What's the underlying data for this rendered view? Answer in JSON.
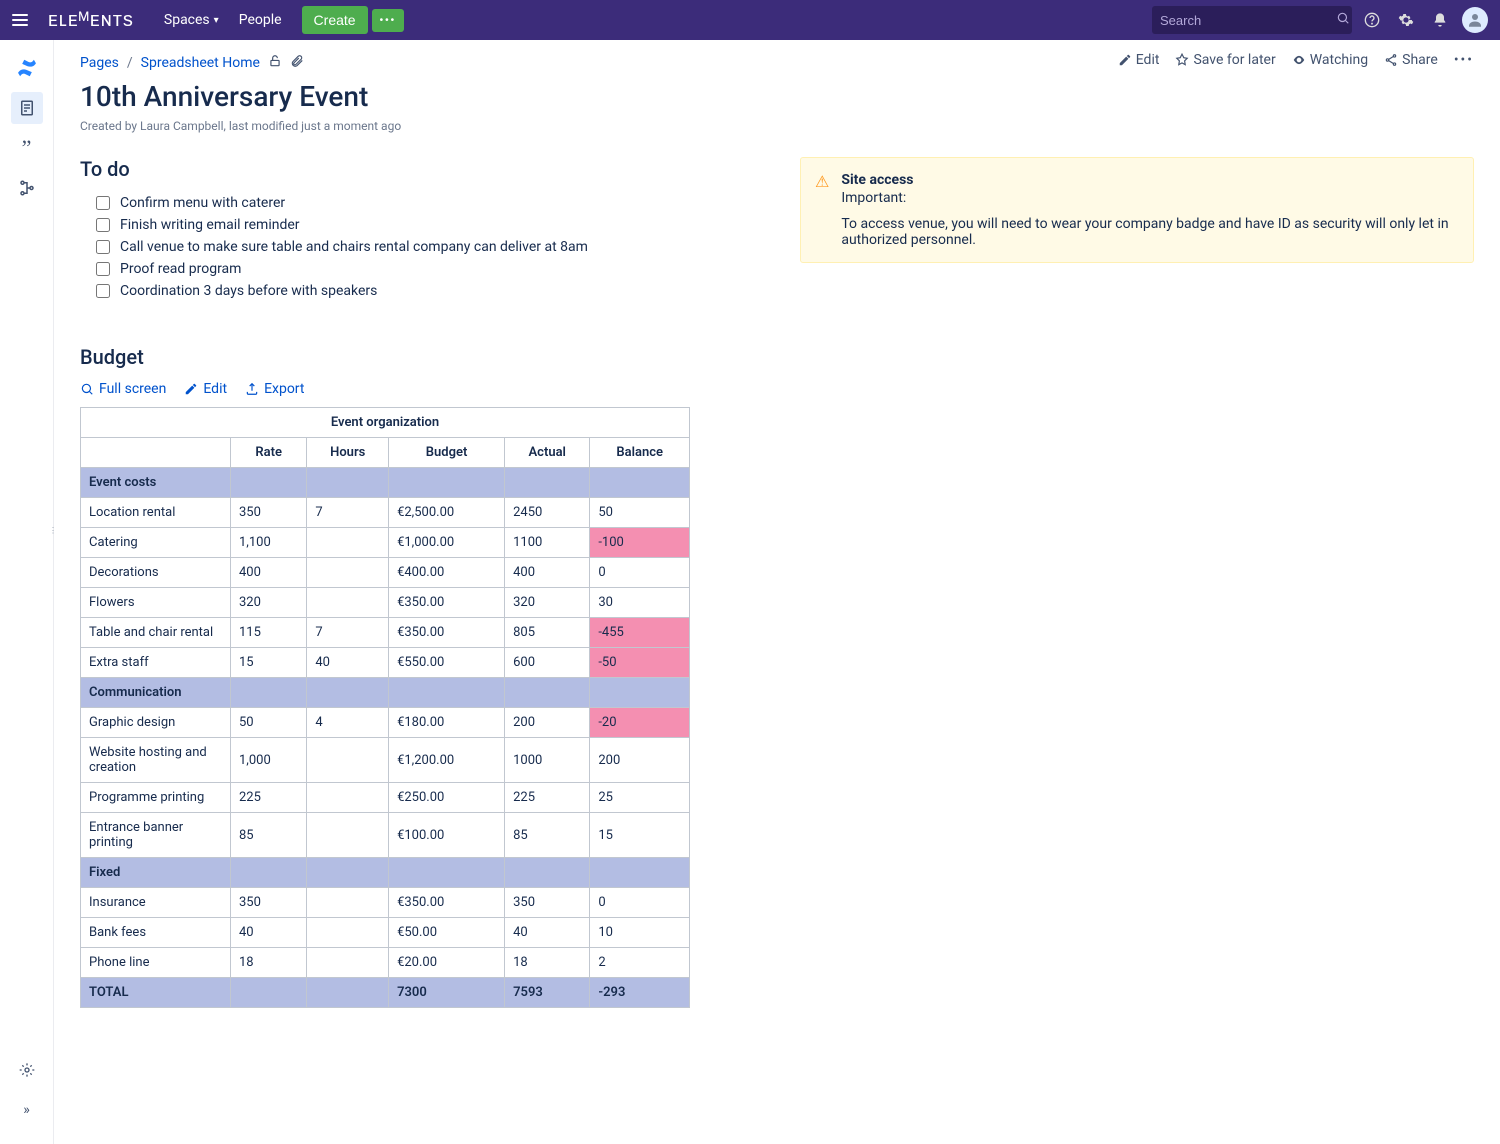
{
  "topbar": {
    "logo": "ᴇʟᴇᴹᴇɴᴛs",
    "spaces": "Spaces",
    "people": "People",
    "create": "Create",
    "more": "•••",
    "search_placeholder": "Search"
  },
  "breadcrumb": {
    "pages": "Pages",
    "home": "Spreadsheet Home"
  },
  "actions": {
    "edit": "Edit",
    "save": "Save for later",
    "watching": "Watching",
    "share": "Share"
  },
  "page": {
    "title": "10th Anniversary Event",
    "byline": "Created by Laura Campbell, last modified just a moment ago"
  },
  "todo": {
    "heading": "To do",
    "items": [
      "Confirm menu with caterer",
      "Finish writing email reminder",
      "Call venue to make sure table and chairs rental company can deliver at 8am",
      "Proof read program",
      "Coordination 3 days before with speakers"
    ]
  },
  "info": {
    "title": "Site access",
    "subtitle": "Important:",
    "body": "To access venue, you will need to wear your company badge and have ID as security will only let in authorized personnel."
  },
  "budget": {
    "heading": "Budget",
    "toolbar": {
      "fullscreen": "Full screen",
      "edit": "Edit",
      "export": "Export"
    },
    "table_title": "Event organization",
    "columns": [
      "",
      "Rate",
      "Hours",
      "Budget",
      "Actual",
      "Balance"
    ],
    "sections": [
      {
        "name": "Event costs",
        "rows": [
          {
            "label": "Location rental",
            "rate": "350",
            "hours": "7",
            "budget": "€2,500.00",
            "actual": "2450",
            "balance": "50",
            "neg": false
          },
          {
            "label": "Catering",
            "rate": "1,100",
            "hours": "",
            "budget": "€1,000.00",
            "actual": "1100",
            "balance": "-100",
            "neg": true
          },
          {
            "label": "Decorations",
            "rate": "400",
            "hours": "",
            "budget": "€400.00",
            "actual": "400",
            "balance": "0",
            "neg": false
          },
          {
            "label": "Flowers",
            "rate": "320",
            "hours": "",
            "budget": "€350.00",
            "actual": "320",
            "balance": "30",
            "neg": false
          },
          {
            "label": "Table and chair rental",
            "rate": "115",
            "hours": "7",
            "budget": "€350.00",
            "actual": "805",
            "balance": "-455",
            "neg": true
          },
          {
            "label": "Extra staff",
            "rate": "15",
            "hours": "40",
            "budget": "€550.00",
            "actual": "600",
            "balance": "-50",
            "neg": true
          }
        ]
      },
      {
        "name": "Communication",
        "rows": [
          {
            "label": "Graphic design",
            "rate": "50",
            "hours": "4",
            "budget": "€180.00",
            "actual": "200",
            "balance": "-20",
            "neg": true
          },
          {
            "label": "Website hosting and creation",
            "rate": "1,000",
            "hours": "",
            "budget": "€1,200.00",
            "actual": "1000",
            "balance": "200",
            "neg": false
          },
          {
            "label": "Programme printing",
            "rate": "225",
            "hours": "",
            "budget": "€250.00",
            "actual": "225",
            "balance": "25",
            "neg": false
          },
          {
            "label": "Entrance banner printing",
            "rate": "85",
            "hours": "",
            "budget": "€100.00",
            "actual": "85",
            "balance": "15",
            "neg": false
          }
        ]
      },
      {
        "name": "Fixed",
        "rows": [
          {
            "label": "Insurance",
            "rate": "350",
            "hours": "",
            "budget": "€350.00",
            "actual": "350",
            "balance": "0",
            "neg": false
          },
          {
            "label": "Bank fees",
            "rate": "40",
            "hours": "",
            "budget": "€50.00",
            "actual": "40",
            "balance": "10",
            "neg": false
          },
          {
            "label": "Phone line",
            "rate": "18",
            "hours": "",
            "budget": "€20.00",
            "actual": "18",
            "balance": "2",
            "neg": false
          }
        ]
      }
    ],
    "total": {
      "label": "TOTAL",
      "budget": "7300",
      "actual": "7593",
      "balance": "-293"
    }
  }
}
